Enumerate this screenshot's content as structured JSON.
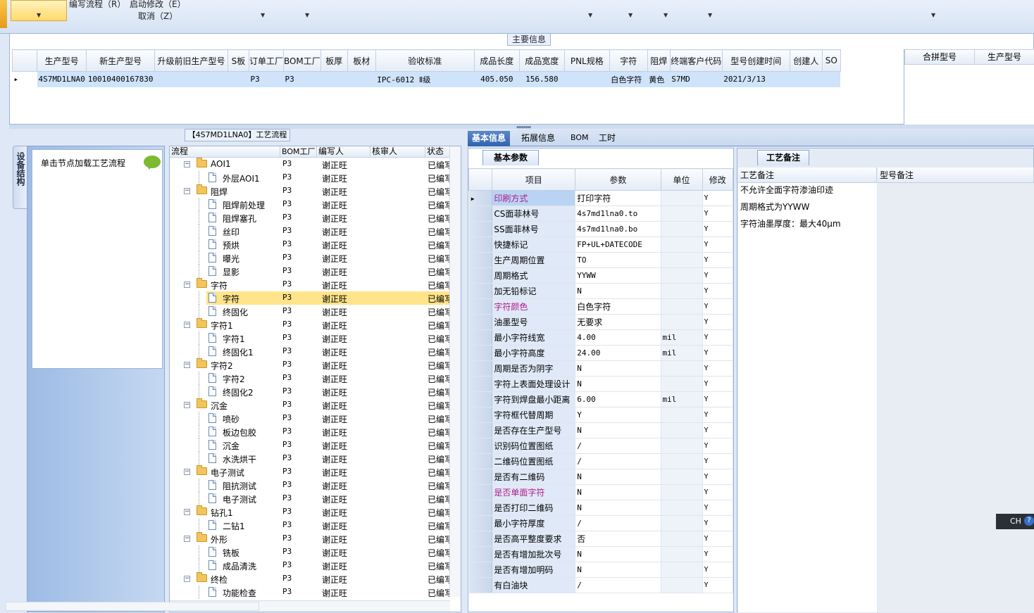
{
  "toolbar": {
    "items": [
      "编写流程（R）",
      "启动修改（E）",
      "取消（Z）"
    ]
  },
  "main_info": {
    "title": "主要信息",
    "columns": [
      "生产型号",
      "新生产型号",
      "升级前旧生产型号",
      "S板",
      "订单工厂",
      "BOM工厂",
      "板厚",
      "板材",
      "验收标准",
      "成品长度",
      "成品宽度",
      "PNL规格",
      "字符",
      "阻焊",
      "终端客户代码",
      "型号创建时间",
      "创建人",
      "SO"
    ],
    "rows": [
      [
        "4S7MD1LNA0",
        "10010400167830",
        "",
        "",
        "P3",
        "P3",
        "",
        "",
        "IPC-6012 Ⅱ级",
        "405.050",
        "156.580",
        "",
        "白色字符",
        "黄色",
        "S7MD",
        "2021/3/13",
        "",
        ""
      ]
    ],
    "merge_columns": [
      "合拼型号",
      "生产型号"
    ]
  },
  "device_panel": {
    "tab_label": "设备结构",
    "hint": "单击节点加载工艺流程"
  },
  "process_panel": {
    "title": "【4S7MD1LNA0】工艺流程",
    "columns": [
      "流程",
      "BOM工厂",
      "编写人",
      "核审人",
      "状态"
    ],
    "rows": [
      {
        "level": 0,
        "type": "folder",
        "name": "AOI1",
        "bom": "P3",
        "writer": "谢正旺",
        "status": "已编写"
      },
      {
        "level": 1,
        "type": "doc",
        "name": "外层AOI1",
        "bom": "P3",
        "writer": "谢正旺",
        "status": "已编写"
      },
      {
        "level": 0,
        "type": "folder",
        "name": "阻焊",
        "bom": "P3",
        "writer": "谢正旺",
        "status": "已编写"
      },
      {
        "level": 1,
        "type": "doc",
        "name": "阻焊前处理",
        "bom": "P3",
        "writer": "谢正旺",
        "status": "已编写"
      },
      {
        "level": 1,
        "type": "doc",
        "name": "阻焊塞孔",
        "bom": "P3",
        "writer": "谢正旺",
        "status": "已编写"
      },
      {
        "level": 1,
        "type": "doc",
        "name": "丝印",
        "bom": "P3",
        "writer": "谢正旺",
        "status": "已编写"
      },
      {
        "level": 1,
        "type": "doc",
        "name": "预烘",
        "bom": "P3",
        "writer": "谢正旺",
        "status": "已编写"
      },
      {
        "level": 1,
        "type": "doc",
        "name": "曝光",
        "bom": "P3",
        "writer": "谢正旺",
        "status": "已编写"
      },
      {
        "level": 1,
        "type": "doc",
        "name": "显影",
        "bom": "P3",
        "writer": "谢正旺",
        "status": "已编写"
      },
      {
        "level": 0,
        "type": "folder",
        "name": "字符",
        "bom": "P3",
        "writer": "谢正旺",
        "status": "已编写"
      },
      {
        "level": 1,
        "type": "doc",
        "name": "字符",
        "bom": "P3",
        "writer": "谢正旺",
        "status": "已编写",
        "selected": true
      },
      {
        "level": 1,
        "type": "doc",
        "name": "终固化",
        "bom": "P3",
        "writer": "谢正旺",
        "status": "已编写"
      },
      {
        "level": 0,
        "type": "folder",
        "name": "字符1",
        "bom": "P3",
        "writer": "谢正旺",
        "status": "已编写"
      },
      {
        "level": 1,
        "type": "doc",
        "name": "字符1",
        "bom": "P3",
        "writer": "谢正旺",
        "status": "已编写"
      },
      {
        "level": 1,
        "type": "doc",
        "name": "终固化1",
        "bom": "P3",
        "writer": "谢正旺",
        "status": "已编写"
      },
      {
        "level": 0,
        "type": "folder",
        "name": "字符2",
        "bom": "P3",
        "writer": "谢正旺",
        "status": "已编写"
      },
      {
        "level": 1,
        "type": "doc",
        "name": "字符2",
        "bom": "P3",
        "writer": "谢正旺",
        "status": "已编写"
      },
      {
        "level": 1,
        "type": "doc",
        "name": "终固化2",
        "bom": "P3",
        "writer": "谢正旺",
        "status": "已编写"
      },
      {
        "level": 0,
        "type": "folder",
        "name": "沉金",
        "bom": "P3",
        "writer": "谢正旺",
        "status": "已编写"
      },
      {
        "level": 1,
        "type": "doc",
        "name": "喷砂",
        "bom": "P3",
        "writer": "谢正旺",
        "status": "已编写"
      },
      {
        "level": 1,
        "type": "doc",
        "name": "板边包胶",
        "bom": "P3",
        "writer": "谢正旺",
        "status": "已编写"
      },
      {
        "level": 1,
        "type": "doc",
        "name": "沉金",
        "bom": "P3",
        "writer": "谢正旺",
        "status": "已编写"
      },
      {
        "level": 1,
        "type": "doc",
        "name": "水洗烘干",
        "bom": "P3",
        "writer": "谢正旺",
        "status": "已编写"
      },
      {
        "level": 0,
        "type": "folder",
        "name": "电子测试",
        "bom": "P3",
        "writer": "谢正旺",
        "status": "已编写"
      },
      {
        "level": 1,
        "type": "doc",
        "name": "阻抗测试",
        "bom": "P3",
        "writer": "谢正旺",
        "status": "已编写"
      },
      {
        "level": 1,
        "type": "doc",
        "name": "电子测试",
        "bom": "P3",
        "writer": "谢正旺",
        "status": "已编写"
      },
      {
        "level": 0,
        "type": "folder",
        "name": "钻孔1",
        "bom": "P3",
        "writer": "谢正旺",
        "status": "已编写"
      },
      {
        "level": 1,
        "type": "doc",
        "name": "二钻1",
        "bom": "P3",
        "writer": "谢正旺",
        "status": "已编写"
      },
      {
        "level": 0,
        "type": "folder",
        "name": "外形",
        "bom": "P3",
        "writer": "谢正旺",
        "status": "已编写"
      },
      {
        "level": 1,
        "type": "doc",
        "name": "铣板",
        "bom": "P3",
        "writer": "谢正旺",
        "status": "已编写"
      },
      {
        "level": 1,
        "type": "doc",
        "name": "成品清洗",
        "bom": "P3",
        "writer": "谢正旺",
        "status": "已编写"
      },
      {
        "level": 0,
        "type": "folder",
        "name": "终检",
        "bom": "P3",
        "writer": "谢正旺",
        "status": "已编写"
      },
      {
        "level": 1,
        "type": "doc",
        "name": "功能检查",
        "bom": "P3",
        "writer": "谢正旺",
        "status": "已编写"
      }
    ]
  },
  "right_tabs": [
    "基本信息",
    "拓展信息",
    "BOM",
    "工时"
  ],
  "basic_params": {
    "subtab": "基本参数",
    "columns": [
      "项目",
      "参数",
      "单位",
      "修改"
    ],
    "rows": [
      {
        "item": "印刷方式",
        "value": "打印字符",
        "unit": "",
        "mod": "Y",
        "pink": true
      },
      {
        "item": "CS面菲林号",
        "value": "4s7md1lna0.to",
        "unit": "",
        "mod": "Y"
      },
      {
        "item": "SS面菲林号",
        "value": "4s7md1lna0.bo",
        "unit": "",
        "mod": "Y"
      },
      {
        "item": "快捷标记",
        "value": "FP+UL+DATECODE",
        "unit": "",
        "mod": "Y"
      },
      {
        "item": "生产周期位置",
        "value": "TO",
        "unit": "",
        "mod": "Y"
      },
      {
        "item": "周期格式",
        "value": "YYWW",
        "unit": "",
        "mod": "Y"
      },
      {
        "item": "加无铅标记",
        "value": "N",
        "unit": "",
        "mod": "Y"
      },
      {
        "item": "字符颜色",
        "value": "白色字符",
        "unit": "",
        "mod": "Y",
        "pink": true
      },
      {
        "item": "油墨型号",
        "value": "无要求",
        "unit": "",
        "mod": "Y"
      },
      {
        "item": "最小字符线宽",
        "value": "4.00",
        "unit": "mil",
        "mod": "Y"
      },
      {
        "item": "最小字符高度",
        "value": "24.00",
        "unit": "mil",
        "mod": "Y"
      },
      {
        "item": "周期是否为阴字",
        "value": "N",
        "unit": "",
        "mod": "Y"
      },
      {
        "item": "字符上表面处理设计",
        "value": "N",
        "unit": "",
        "mod": "Y"
      },
      {
        "item": "字符到焊盘最小距离",
        "value": "6.00",
        "unit": "mil",
        "mod": "Y"
      },
      {
        "item": "字符框代替周期",
        "value": "Y",
        "unit": "",
        "mod": "Y"
      },
      {
        "item": "是否存在生产型号",
        "value": "N",
        "unit": "",
        "mod": "Y"
      },
      {
        "item": "识别码位置图纸",
        "value": "/",
        "unit": "",
        "mod": "Y"
      },
      {
        "item": "二维码位置图纸",
        "value": "/",
        "unit": "",
        "mod": "Y"
      },
      {
        "item": "是否有二维码",
        "value": "N",
        "unit": "",
        "mod": "Y"
      },
      {
        "item": "是否单面字符",
        "value": "N",
        "unit": "",
        "mod": "Y",
        "pink": true
      },
      {
        "item": "是否打印二维码",
        "value": "N",
        "unit": "",
        "mod": "Y"
      },
      {
        "item": "最小字符厚度",
        "value": "/",
        "unit": "",
        "mod": "Y"
      },
      {
        "item": "是否高平整度要求",
        "value": "否",
        "unit": "",
        "mod": "Y"
      },
      {
        "item": "是否有增加批次号",
        "value": "N",
        "unit": "",
        "mod": "Y"
      },
      {
        "item": "是否有增加明码",
        "value": "N",
        "unit": "",
        "mod": "Y"
      },
      {
        "item": "有白油块",
        "value": "/",
        "unit": "",
        "mod": "Y"
      }
    ]
  },
  "notes": {
    "subtab": "工艺备注",
    "process_notes_header": "工艺备注",
    "model_notes_header": "型号备注",
    "lines": [
      "不允许全面字符渗油印迹",
      "周期格式为YYWW",
      "字符油墨厚度：最大40μm"
    ]
  },
  "ime": {
    "label": "CH",
    "help": "?"
  }
}
